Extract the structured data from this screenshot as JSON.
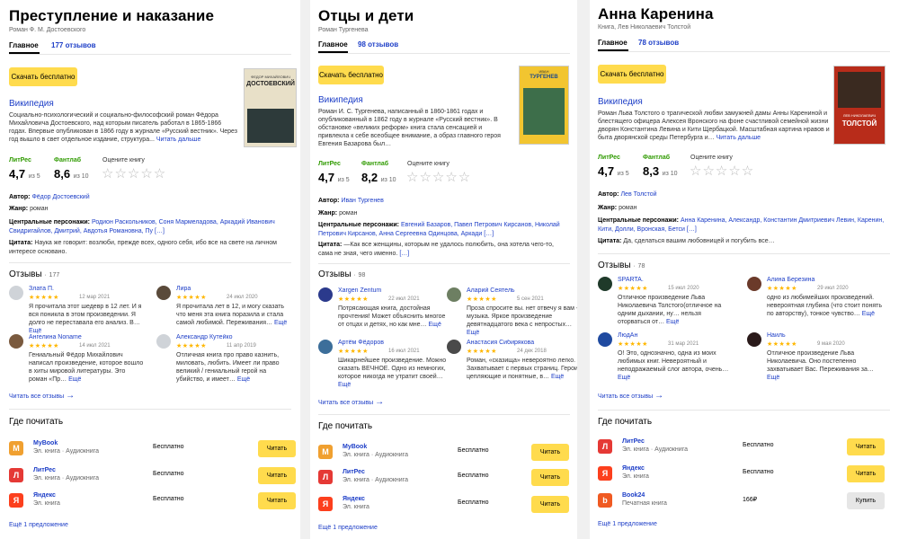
{
  "colors": {
    "accent": "#ffdb4d",
    "link": "#1d3ec7",
    "litres_green": "#2f9a00",
    "star": "#ffb700",
    "star_empty": "#bbbbbb"
  },
  "icons": {
    "rate_star": "empty-star-icon",
    "review_star": "filled-star-icon",
    "arrow": "arrow-right-icon"
  },
  "common": {
    "download": "Скачать бесплатно",
    "wiki": "Википедия",
    "read_more": "Читать дальше",
    "more": "Ещё",
    "litres_label": "ЛитРес",
    "fantlab_label": "Фантлаб",
    "rate_label": "Оцените книгу",
    "of5": "из 5",
    "of10": "из 10",
    "empty_stars": "☆☆☆☆☆",
    "review_stars": "★★★★★",
    "author_label": "Автор:",
    "genre_label": "Жанр:",
    "chars_label": "Центральные персонажи:",
    "quote_label": "Цитата:",
    "reviews_label": "Отзывы",
    "dot": "·",
    "read_all": "Читать все отзывы",
    "arrow": "→",
    "where": "Где почитать",
    "free": "Бесплатно",
    "read_btn": "Читать",
    "buy_btn": "Купить",
    "one_offer": "Ещё 1 предложение"
  },
  "cards": [
    {
      "title": "Преступление и наказание",
      "subtitle": "Роман Ф. М. Достоевского",
      "tab_main": "Главное",
      "tab_reviews": "177 отзывов",
      "cover_top": "ФЕДОР МИХАЙЛОВИЧ",
      "cover_name": "ДОСТОЕВСКИЙ",
      "desc": "Социально-психологический и социально-философский роман Фёдора Михайловича Достоевского, над которым писатель работал в 1865-1866 годах. Впервые опубликован в 1866 году в журнале «Русский вестник». Через год вышло в свет отдельное издание, структура...",
      "litres_rating": "4,7",
      "fantlab_rating": "8,6",
      "author": "Фёдор Достоевский",
      "genre": "роман",
      "characters": "Родион Раскольников, Соня Мармеладова, Аркадий Иванович Свидригайлов, Дмитрий, Авдотья Романовна, Пу",
      "characters_more": "[…]",
      "quote": "Наука же говорит: возлюби, прежде всех, одного себя, ибо все на свете на личном интересе основано.",
      "reviews_count": "177",
      "reviews": [
        {
          "name": "Злата П.",
          "date": "12 мар 2021",
          "text": "Я прочитала этот шедевр в 12 лет. И я вся поникла в этом произведении. Я долго не переставала его анализ. В…",
          "avatar": "#cfd3d8"
        },
        {
          "name": "Лира",
          "date": "24 июл 2020",
          "text": "Я прочитала лет в 12, и могу сказать что меня эта книга поразила и стала самой любимой. Переживания…",
          "avatar": "#5a4a3a"
        },
        {
          "name": "Ангелина Noname",
          "date": "14 июл 2021",
          "text": "Гениальный Фёдор Михайлович написал произведение, которое вошло в хиты мировой литературы. Это роман «Пр…",
          "avatar": "#7a5a3e"
        },
        {
          "name": "Александр Кутейко",
          "date": "11 апр 2019",
          "text": "Отличная книга про право казнить, миловать, любить. Имеет ли право великий / гениальный герой на убийство, и имеет…",
          "avatar": "#cfd3d8"
        }
      ],
      "stores": [
        {
          "name": "MyBook",
          "type": "Эл. книга · Аудиокнига",
          "price": "Бесплатно",
          "btn": "Читать",
          "logo": "M",
          "logo_bg": "#f0a030"
        },
        {
          "name": "ЛитРес",
          "type": "Эл. книга · Аудиокнига",
          "price": "Бесплатно",
          "btn": "Читать",
          "logo": "Л",
          "logo_bg": "#e53935"
        },
        {
          "name": "Яндекс",
          "type": "Эл. книга",
          "price": "Бесплатно",
          "btn": "Читать",
          "logo": "Я",
          "logo_bg": "#fc3f1d"
        }
      ]
    },
    {
      "title": "Отцы и дети",
      "subtitle": "Роман Тургенева",
      "tab_main": "Главное",
      "tab_reviews": "98 отзывов",
      "cover_top": "ИВАН",
      "cover_name": "ТУРГЕНЕВ",
      "desc": "Роман И. С. Тургенева, написанный в 1860-1861 годах и опубликованный в 1862 году в журнале «Русский вестник». В обстановке «великих реформ» книга стала сенсацией и привлекла к себе всеобщее внимание, а образ главного героя Евгения Базарова был…",
      "litres_rating": "4,7",
      "fantlab_rating": "8,2",
      "author": "Иван Тургенев",
      "genre": "роман",
      "characters": "Евгений Базаров, Павел Петрович Кирсанов, Николай Петрович Кирсанов, Анна Сергеевна Одинцова, Аркади",
      "characters_more": "[…]",
      "quote": "—Как все женщины, которым не удалось полюбить, она хотела чего-то, сама не зная, чего именно.",
      "quote_more": "[…]",
      "reviews_count": "98",
      "reviews": [
        {
          "name": "Xargen Zentum",
          "date": "22 июл 2021",
          "text": "Потрясающая книга, достойная прочтения! Может объяснить многое от отцах и детях, но как мне…",
          "avatar": "#2b3a8c"
        },
        {
          "name": "Аларий Сеятель",
          "date": "5 сен 2021",
          "text": "Проза спросите вы. нет отвечу я вам - музыка. Яркое произведение девятнадцатого века с непростых…",
          "avatar": "#6d7f62"
        },
        {
          "name": "Артём Фёдоров",
          "date": "16 июл 2021",
          "text": "Шикарнейшее произведение. Можно сказать ВЕЧНОЕ. Одно из немногих, которое никогда не утратит своей…",
          "avatar": "#3c6e9a"
        },
        {
          "name": "Анастасия Сибирякова",
          "date": "24 дек 2018",
          "text": "Роман, «сказища» невероятно легко. Захватывает с первых страниц. Герои цепляющие и понятные, в…",
          "avatar": "#4a4a4a"
        }
      ],
      "stores": [
        {
          "name": "MyBook",
          "type": "Эл. книга · Аудиокнига",
          "price": "Бесплатно",
          "btn": "Читать",
          "logo": "M",
          "logo_bg": "#f0a030"
        },
        {
          "name": "ЛитРес",
          "type": "Эл. книга · Аудиокнига",
          "price": "Бесплатно",
          "btn": "Читать",
          "logo": "Л",
          "logo_bg": "#e53935"
        },
        {
          "name": "Яндекс",
          "type": "Эл. книга",
          "price": "Бесплатно",
          "btn": "Читать",
          "logo": "Я",
          "logo_bg": "#fc3f1d"
        }
      ]
    },
    {
      "title": "Анна Каренина",
      "subtitle": "Книга, Лев Николаевич Толстой",
      "tab_main": "Главное",
      "tab_reviews": "78 отзывов",
      "cover_top": "ЛЕВ НИКОЛАЕВИЧ",
      "cover_name": "ТОЛСТОЙ",
      "desc": "Роман Льва Толстого о трагической любви замужней дамы Анны Карениной и блестящего офицера Алексея Вронского на фоне счастливой семейной жизни дворян Константина Левина и Кити Щербацкой. Масштабная картина нравов и быта дворянской среды Петербурга и…",
      "litres_rating": "4,7",
      "fantlab_rating": "8,3",
      "author": "Лев Толстой",
      "genre": "роман",
      "characters": "Анна Каренина, Александр, Константин Дмитриевич Левин, Каренин, Кити, Долли, Вронская, Бетси",
      "characters_more": "[…]",
      "quote": "Да, сделаться вашим любовницей и погубить все…",
      "reviews_count": "78",
      "reviews": [
        {
          "name": "SPARTA.",
          "date": "15 июл 2020",
          "text": "Отличное произведение Льва Николаевича Толстого(отличное на одним дыхании, ну… нельзя оторваться от…",
          "avatar": "#1f3a2a"
        },
        {
          "name": "Алина Березина",
          "date": "29 июл 2020",
          "text": "одно из любимейших произведений. невероятная глубина (что стоит понять по авторству), тонкое чувство…",
          "avatar": "#6b3a2a"
        },
        {
          "name": "ЛюдАн",
          "date": "31 мар 2021",
          "text": "О! Это, однозначно, одна из моих любимых книг. Невероятный и неподражаемый слог автора, очень…",
          "avatar": "#1f4aa0"
        },
        {
          "name": "Наиль",
          "date": "9 мая 2020",
          "text": "Отличное произведение Льва Николаевича. Оно постепенно захватывает Вас. Переживания за…",
          "avatar": "#2a1a1a"
        }
      ],
      "stores": [
        {
          "name": "ЛитРес",
          "type": "Эл. книга · Аудиокнига",
          "price": "Бесплатно",
          "btn": "Читать",
          "logo": "Л",
          "logo_bg": "#e53935"
        },
        {
          "name": "Яндекс",
          "type": "Эл. книга",
          "price": "Бесплатно",
          "btn": "Читать",
          "logo": "Я",
          "logo_bg": "#fc3f1d"
        },
        {
          "name": "Book24",
          "type": "Печатная книга",
          "price": "166₽",
          "btn": "Купить",
          "logo": "b",
          "logo_bg": "#f05a22"
        }
      ]
    }
  ]
}
